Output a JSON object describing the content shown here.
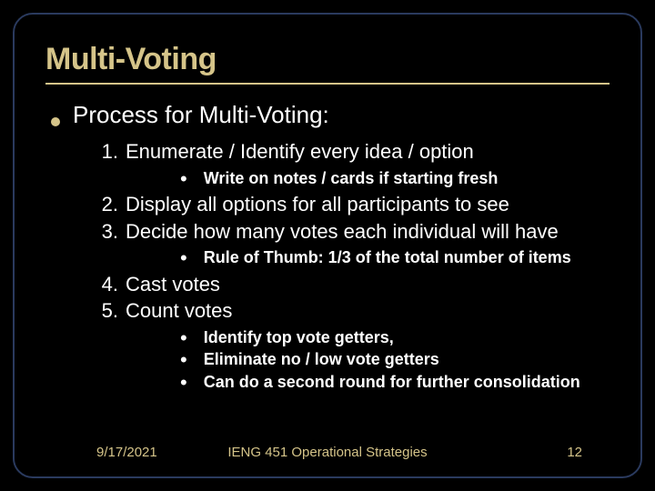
{
  "slide": {
    "title": "Multi-Voting",
    "heading": "Process for Multi-Voting:",
    "items": {
      "n1": "1.",
      "t1": "Enumerate / Identify every idea / option",
      "s1a": "Write on notes / cards if starting fresh",
      "n2": "2.",
      "t2": "Display all options for all participants to see",
      "n3": "3.",
      "t3": "Decide how many votes each individual will have",
      "s3a": "Rule of Thumb:  1/3 of the total number of items",
      "n4": "4.",
      "t4": "Cast votes",
      "n5": "5.",
      "t5": "Count votes",
      "s5a": "Identify top vote getters,",
      "s5b": "Eliminate no / low vote getters",
      "s5c": "Can do a second round for further consolidation"
    }
  },
  "footer": {
    "date": "9/17/2021",
    "course": "IENG 451 Operational Strategies",
    "page": "12"
  }
}
